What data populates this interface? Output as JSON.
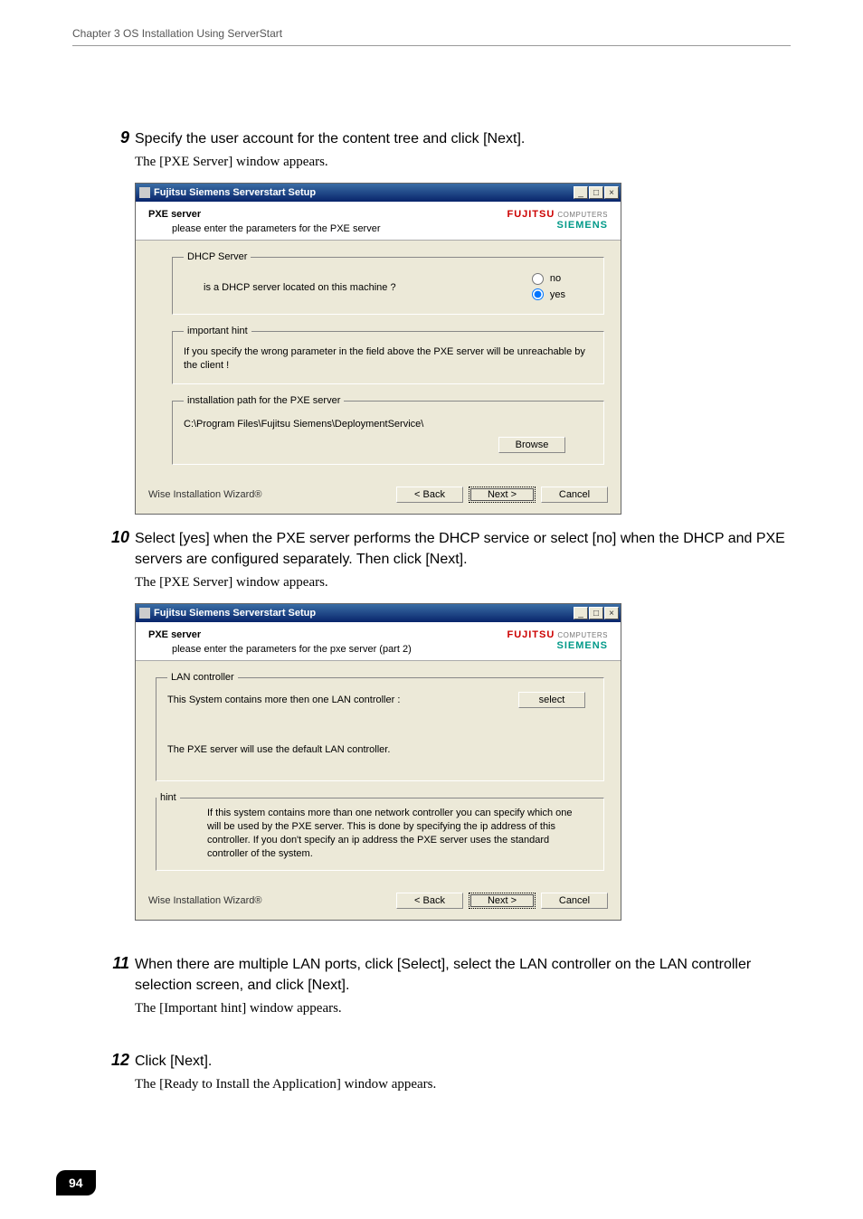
{
  "chapter_header": "Chapter 3  OS Installation Using ServerStart",
  "page_number": "94",
  "steps": {
    "s9": {
      "num": "9",
      "title": "Specify the user account for the content tree and click [Next].",
      "sub": "The [PXE Server] window appears."
    },
    "s10": {
      "num": "10",
      "title": "Select [yes] when the PXE server performs the DHCP service or select [no] when the DHCP and PXE servers are configured separately. Then click [Next].",
      "sub": "The [PXE Server] window appears."
    },
    "s11": {
      "num": "11",
      "title": "When there are multiple LAN ports, click [Select], select the LAN controller on the LAN controller selection screen, and click [Next].",
      "sub": "The [Important hint] window appears."
    },
    "s12": {
      "num": "12",
      "title": "Click [Next].",
      "sub": "The [Ready to Install the Application] window appears."
    }
  },
  "win1": {
    "title": "Fujitsu Siemens Serverstart Setup",
    "header_title": "PXE server",
    "header_sub": "please enter the parameters for the PXE server",
    "brand_fj": "FUJITSU",
    "brand_cmp": "COMPUTERS",
    "brand_sm": "SIEMENS",
    "dhcp_legend": "DHCP Server",
    "dhcp_q": "is a DHCP server located on this machine ?",
    "radio_no": "no",
    "radio_yes": "yes",
    "hint_legend": "important hint",
    "hint_text": "If you specify the wrong parameter in the field above the PXE server will be unreachable by the client !",
    "install_legend": "installation path for the PXE server",
    "install_path": "C:\\Program Files\\Fujitsu Siemens\\DeploymentService\\",
    "browse_btn": "Browse",
    "wizard": "Wise Installation Wizard®",
    "back": "< Back",
    "next": "Next >",
    "cancel": "Cancel"
  },
  "win2": {
    "title": "Fujitsu Siemens Serverstart Setup",
    "header_title": "PXE server",
    "header_sub": "please enter the parameters for the pxe server (part 2)",
    "brand_fj": "FUJITSU",
    "brand_cmp": "COMPUTERS",
    "brand_sm": "SIEMENS",
    "lan_legend": "LAN controller",
    "lan_line1": "This System contains more then one LAN controller :",
    "lan_line2": "The PXE server will use the default LAN controller.",
    "select_btn": "select",
    "hint_legend": "hint",
    "hint_text": "If this system contains more than one network controller you can specify which one will be used by the PXE server. This is done by specifying the ip address of this controller. If you don't specify an ip address the PXE server uses the standard controller of the system.",
    "wizard": "Wise Installation Wizard®",
    "back": "< Back",
    "next": "Next >",
    "cancel": "Cancel"
  }
}
